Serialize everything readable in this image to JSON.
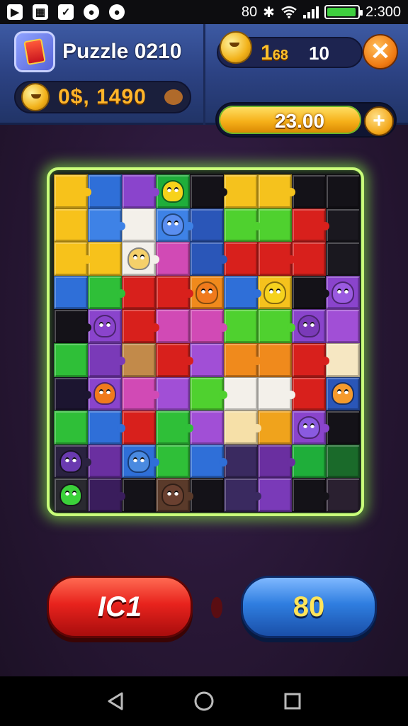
{
  "status_bar": {
    "time": "2:300",
    "left_icons": [
      "play-store-icon",
      "image-icon",
      "shield-icon",
      "game-controller-icon",
      "game-controller-icon"
    ],
    "right_text": "80",
    "battery_level": 0.95
  },
  "header": {
    "title": "Puzzle 0210",
    "coins": "0$, 1490",
    "score_primary": "1",
    "score_primary_sub": "68",
    "score_secondary": "10",
    "progress_text": "23.00",
    "progress_level": 0.82,
    "close_icon": "close-icon",
    "plus_icon": "plus-icon"
  },
  "board": {
    "columns": 9,
    "rows": 10,
    "tiles": [
      [
        "#f7c21b",
        "#2f6fd8",
        "#8a44cc",
        "#1fae3a",
        "#141218",
        "#f5c21d",
        "#f5c21d",
        "#141218",
        "#141218"
      ],
      [
        "#f7c21b",
        "#3e82e6",
        "#f3f0ea",
        "#3e82e6",
        "#2a56b8",
        "#4fd12f",
        "#4fd12f",
        "#d8201c",
        "#1a181f"
      ],
      [
        "#f7c21b",
        "#f7c21b",
        "#f3f0ea",
        "#d14ab5",
        "#2a56b8",
        "#d8201c",
        "#d8201c",
        "#d8201c",
        "#1a181f"
      ],
      [
        "#2f6fd8",
        "#2fbf38",
        "#d8201c",
        "#d8201c",
        "#f08a1c",
        "#2f6fd8",
        "#f5c21d",
        "#141218",
        "#8a44cc"
      ],
      [
        "#141218",
        "#8a44cc",
        "#d8201c",
        "#d14ab5",
        "#d14ab5",
        "#4fd12f",
        "#4fd12f",
        "#8a44cc",
        "#a14fd6"
      ],
      [
        "#2fbf38",
        "#7a3ab8",
        "#c28a4a",
        "#d8201c",
        "#a14fd6",
        "#f08a1c",
        "#f08a1c",
        "#d8201c",
        "#f6e7c2"
      ],
      [
        "#1c1530",
        "#8a44cc",
        "#d14ab5",
        "#a14fd6",
        "#4fd12f",
        "#f3f0ea",
        "#f3f0ea",
        "#d8201c",
        "#2a56b8"
      ],
      [
        "#2fbf38",
        "#2f6fd8",
        "#d8201c",
        "#2fbf38",
        "#a14fd6",
        "#f6e0a8",
        "#f0a31c",
        "#8a44cc",
        "#141218"
      ],
      [
        "#2a2240",
        "#6a2fa0",
        "#2f6fd8",
        "#2fbf38",
        "#2f6fd8",
        "#3a2a60",
        "#6a2fa0",
        "#1fae3a",
        "#1a6a2a"
      ],
      [
        "#2a2a30",
        "#3a1d5c",
        "#141218",
        "#5a3a2a",
        "#141218",
        "#3a2a60",
        "#7a3ab8",
        "#141218",
        "#2a2030"
      ]
    ],
    "characters": [
      {
        "row": 0,
        "col": 3,
        "name": "yellow-creature-icon",
        "color": "#f7d21b"
      },
      {
        "row": 1,
        "col": 3,
        "name": "blue-creature-icon",
        "color": "#5a8ef0"
      },
      {
        "row": 2,
        "col": 2,
        "name": "egg-creature-icon",
        "color": "#f5d06a"
      },
      {
        "row": 3,
        "col": 4,
        "name": "orange-creature-icon",
        "color": "#f07a1c"
      },
      {
        "row": 3,
        "col": 6,
        "name": "yellow-blob-icon",
        "color": "#f5d21d"
      },
      {
        "row": 3,
        "col": 8,
        "name": "purple-ghost-icon",
        "color": "#9a5ae0"
      },
      {
        "row": 4,
        "col": 1,
        "name": "purple-monster-icon",
        "color": "#8a44cc"
      },
      {
        "row": 4,
        "col": 7,
        "name": "purple-monster-icon",
        "color": "#7a3ab8"
      },
      {
        "row": 6,
        "col": 1,
        "name": "orange-creature-icon",
        "color": "#f07a1c"
      },
      {
        "row": 6,
        "col": 8,
        "name": "orange-face-icon",
        "color": "#f59a2c"
      },
      {
        "row": 7,
        "col": 7,
        "name": "purple-ghost-icon",
        "color": "#8a5ae0"
      },
      {
        "row": 8,
        "col": 0,
        "name": "purple-ghost-icon",
        "color": "#6a3ab0"
      },
      {
        "row": 8,
        "col": 2,
        "name": "blue-creature-icon",
        "color": "#4a8ae0"
      },
      {
        "row": 9,
        "col": 0,
        "name": "green-blob-icon",
        "color": "#3bd13a"
      },
      {
        "row": 9,
        "col": 3,
        "name": "brown-creature-icon",
        "color": "#6a4030"
      }
    ]
  },
  "buttons": {
    "left_label": "IC1",
    "right_label": "80"
  },
  "nav": {
    "back_icon": "back-triangle-icon",
    "home_icon": "home-circle-icon",
    "recents_icon": "recents-square-icon"
  }
}
